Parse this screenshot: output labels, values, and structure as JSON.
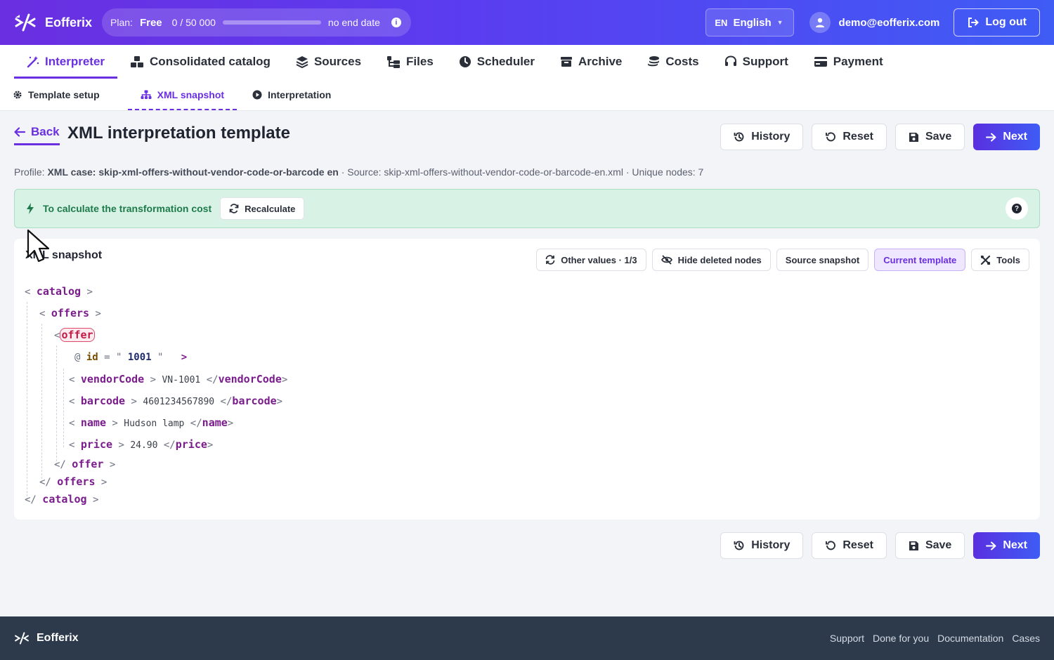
{
  "app": {
    "brand": "Eofferix"
  },
  "plan": {
    "label": "Plan:",
    "name": "Free",
    "usage": "0 / 50 000",
    "usage_fraction": 0.0,
    "end_date": "no end date"
  },
  "language": {
    "code": "EN",
    "name": "English"
  },
  "user": {
    "email": "demo@eofferix.com"
  },
  "logout_label": "Log out",
  "nav": {
    "items": [
      {
        "label": "Interpreter",
        "icon": "magic-wand-icon"
      },
      {
        "label": "Consolidated catalog",
        "icon": "cubes-icon"
      },
      {
        "label": "Sources",
        "icon": "layers-icon"
      },
      {
        "label": "Files",
        "icon": "folder-tree-icon"
      },
      {
        "label": "Scheduler",
        "icon": "clock-icon"
      },
      {
        "label": "Archive",
        "icon": "archive-icon"
      },
      {
        "label": "Costs",
        "icon": "coins-icon"
      },
      {
        "label": "Support",
        "icon": "headset-icon"
      },
      {
        "label": "Payment",
        "icon": "credit-card-icon"
      }
    ]
  },
  "subnav": {
    "items": [
      {
        "label": "Template setup"
      },
      {
        "label": "XML snapshot"
      },
      {
        "label": "Interpretation"
      }
    ]
  },
  "header": {
    "back_label": "Back",
    "title": "XML interpretation template"
  },
  "actions": {
    "history": "History",
    "reset": "Reset",
    "save": "Save",
    "next": "Next"
  },
  "profile": {
    "profile_label": "Profile:",
    "profile_name": "XML case: skip-xml-offers-without-vendor-code-or-barcode en",
    "source_label": "· Source: skip-xml-offers-without-vendor-code-or-barcode-en.xml",
    "unique_label": "· Unique nodes: 7"
  },
  "alert": {
    "message": "To calculate the transformation cost",
    "recalculate": "Recalculate"
  },
  "snapshot": {
    "title": "XML snapshot",
    "tools": {
      "other_values": "Other values · 1/3",
      "hide_deleted": "Hide deleted nodes",
      "source_snapshot": "Source snapshot",
      "current_template": "Current template",
      "tools": "Tools"
    },
    "xml": {
      "catalog": "catalog",
      "offers": "offers",
      "offer": "offer",
      "attr_name": "id",
      "attr_value": "1001",
      "vendorCode": {
        "tag": "vendorCode",
        "value": "VN-1001"
      },
      "barcode": {
        "tag": "barcode",
        "value": "4601234567890"
      },
      "name": {
        "tag": "name",
        "value": "Hudson lamp"
      },
      "price": {
        "tag": "price",
        "value": "24.90"
      }
    }
  },
  "footer": {
    "brand": "Eofferix",
    "links": [
      "Support",
      "Done for you",
      "Documentation",
      "Cases"
    ]
  }
}
